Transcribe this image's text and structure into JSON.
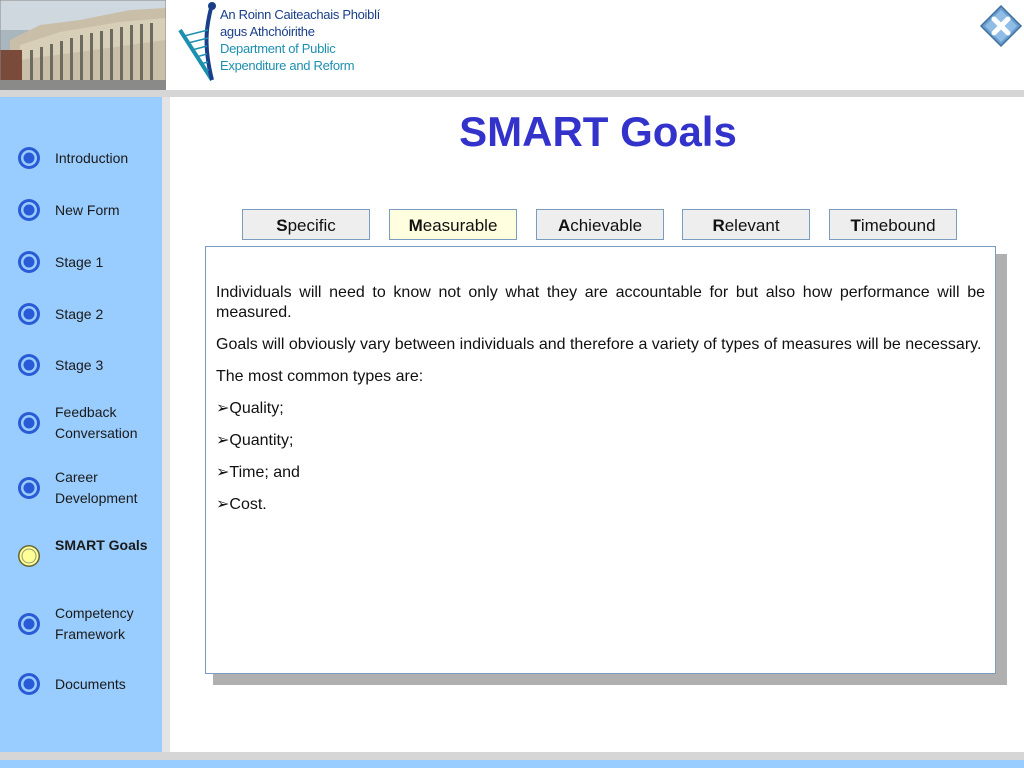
{
  "header": {
    "logo_lines_irish": [
      "An Roinn Caiteachais Phoiblí",
      "agus Athchóirithe"
    ],
    "logo_lines_english": [
      "Department of Public",
      "Expenditure and Reform"
    ]
  },
  "sidebar": {
    "items": [
      {
        "label": "Introduction",
        "active": false
      },
      {
        "label": "New Form",
        "active": false
      },
      {
        "label": "Stage 1",
        "active": false
      },
      {
        "label": "Stage 2",
        "active": false
      },
      {
        "label": "Stage 3",
        "active": false
      },
      {
        "label": "Feedback Conversation",
        "active": false
      },
      {
        "label": "Career Development",
        "active": false
      },
      {
        "label": "SMART Goals",
        "active": true
      },
      {
        "label": "Competency Framework",
        "active": false
      },
      {
        "label": "Documents",
        "active": false
      }
    ]
  },
  "page": {
    "title": "SMART Goals"
  },
  "tabs": [
    {
      "initial": "S",
      "rest": "pecific",
      "active": false
    },
    {
      "initial": "M",
      "rest": "easurable",
      "active": true
    },
    {
      "initial": "A",
      "rest": "chievable",
      "active": false
    },
    {
      "initial": "R",
      "rest": "elevant",
      "active": false
    },
    {
      "initial": "T",
      "rest": "imebound",
      "active": false
    }
  ],
  "content": {
    "paragraphs": [
      "Individuals will need to know not only what they are accountable for but also how performance will be measured.",
      "Goals will obviously vary between individuals and therefore a variety of types of measures will be necessary.",
      "The most common types are:"
    ],
    "bullets": [
      "Quality;",
      "Quantity;",
      "Time; and",
      "Cost."
    ],
    "bullet_glyph": "➢"
  },
  "colors": {
    "sidebar_bg": "#99ccff",
    "title": "#3333cc",
    "active_tab_bg": "#ffffe0",
    "active_dot": "#ffff99"
  },
  "icons": {
    "close": "close-x-icon",
    "nav_dot": "nav-circle-icon"
  }
}
